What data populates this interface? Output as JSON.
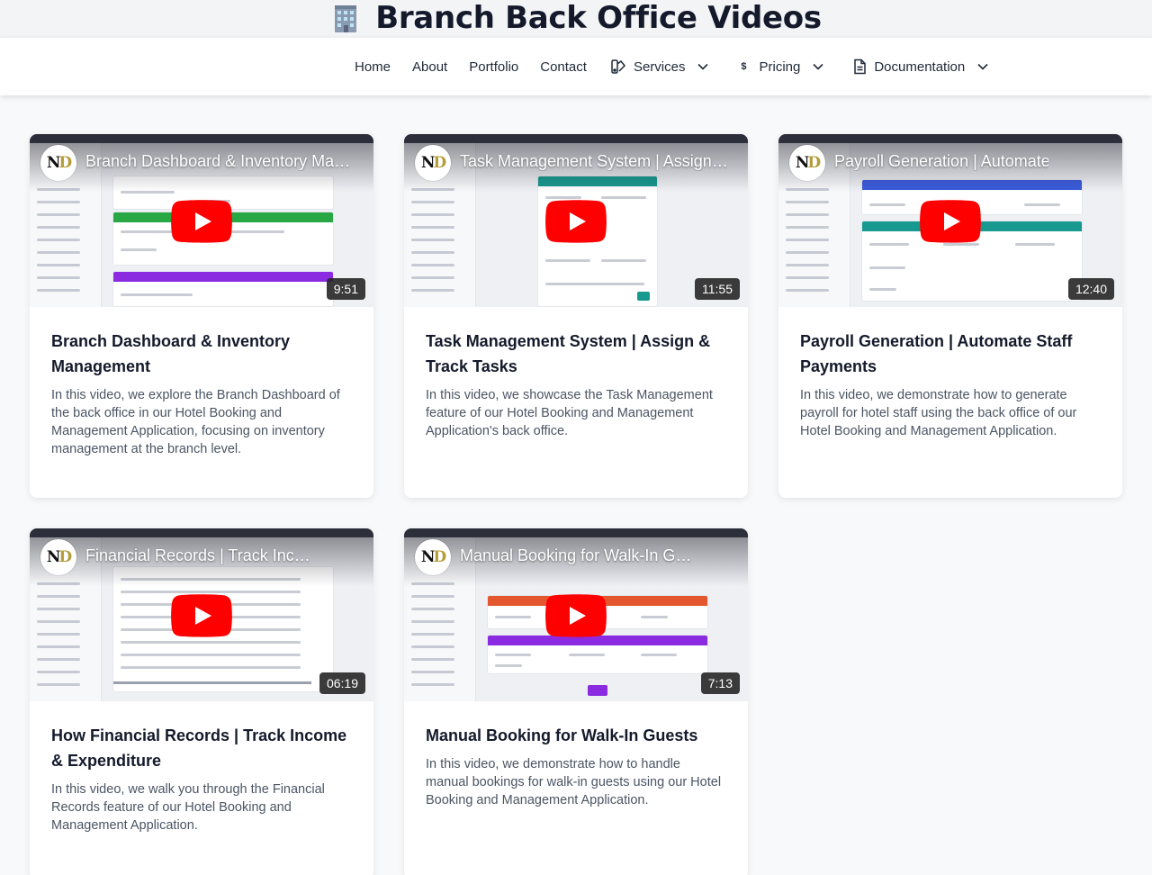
{
  "page": {
    "title": "Branch Back Office Videos",
    "title_icon": "office-building-icon"
  },
  "nav": {
    "items": [
      {
        "label": "Home"
      },
      {
        "label": "About"
      },
      {
        "label": "Portfolio"
      },
      {
        "label": "Contact"
      },
      {
        "label": "Services",
        "icon": "services-icon",
        "dropdown": true
      },
      {
        "label": "Pricing",
        "icon": "dollar-icon",
        "dropdown": true
      },
      {
        "label": "Documentation",
        "icon": "document-icon",
        "dropdown": true
      }
    ]
  },
  "colors": {
    "play_red": "#ff0000",
    "brand_gold": "#b59d3a",
    "blue_panel": "#3b5bdb",
    "green_panel": "#27a844",
    "purple_panel": "#8a2be2",
    "teal_panel": "#17998f",
    "orange_panel": "#e4572e"
  },
  "videos": [
    {
      "thumb_title": "Branch Dashboard & Inventory Management",
      "duration": "9:51",
      "title": "Branch Dashboard & Inventory Management",
      "description": "In this video, we explore the Branch Dashboard of the back office in our Hotel Booking and Management Application, focusing on inventory management at the branch level."
    },
    {
      "thumb_title": "Task Management System | Assign & Track Tasks",
      "duration": "11:55",
      "title": "Task Management System | Assign & Track Tasks",
      "description": "In this video, we showcase the Task Management feature of our Hotel Booking and Management Application's back office."
    },
    {
      "thumb_title": "Payroll Generation | Automate Staff Payments",
      "duration": "12:40",
      "title": "Payroll Generation | Automate Staff Payments",
      "description": "In this video, we demonstrate how to generate payroll for hotel staff using the back office of our Hotel Booking and Management Application."
    },
    {
      "thumb_title": "Financial Records | Track Income & Expenditure",
      "duration": "06:19",
      "title": "How Financial Records | Track Income & Expenditure",
      "description": "In this video, we walk you through the Financial Records feature of our Hotel Booking and Management Application."
    },
    {
      "thumb_title": "Manual Booking for Walk-In Guests",
      "duration": "7:13",
      "title": "Manual Booking for Walk-In Guests",
      "description": "In this video, we demonstrate how to handle manual bookings for walk-in guests using our Hotel Booking and Management Application."
    }
  ]
}
